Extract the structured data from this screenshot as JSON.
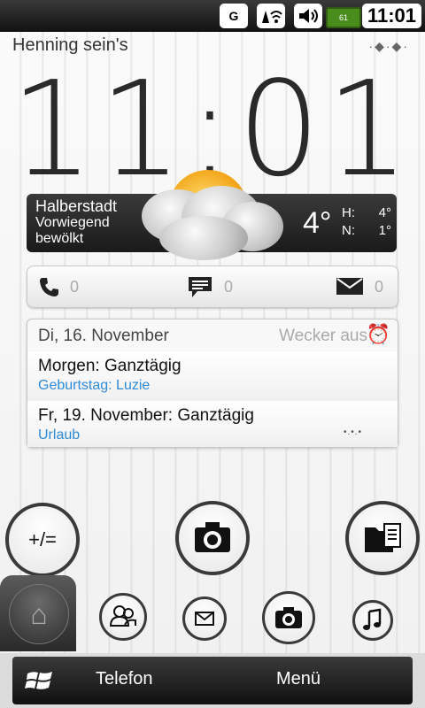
{
  "status_bar": {
    "icons": [
      "g-icon",
      "signal-icon",
      "volume-icon",
      "battery-icon"
    ],
    "g_label": "G",
    "battery_label": "61",
    "time": "11:01"
  },
  "header": {
    "owner": "Henning sein's",
    "sync_icon": "sync-icon"
  },
  "clock": {
    "time": "11:01"
  },
  "weather": {
    "city": "Halberstadt",
    "description": "Vorwiegend bewölkt",
    "temperature": "4°",
    "high_label": "H:",
    "low_label": "N:",
    "high": "4°",
    "low": "1°"
  },
  "counters": {
    "calls": "0",
    "messages": "0",
    "mail": "0"
  },
  "calendar": {
    "date": "Di, 16. November",
    "alarm": "Wecker aus",
    "events": [
      {
        "title": "Morgen: Ganztägig",
        "subtitle": "Geburtstag: Luzie"
      },
      {
        "title": "Fr, 19. November: Ganztägig",
        "subtitle": "Urlaub"
      }
    ]
  },
  "shortcuts": {
    "calculator_label": "+/="
  },
  "bottom_bar": {
    "left": "Telefon",
    "right": "Menü"
  },
  "colors": {
    "link_blue": "#2f8ad8",
    "battery_green": "#4a8c1c",
    "sun": "#f3a61a"
  }
}
